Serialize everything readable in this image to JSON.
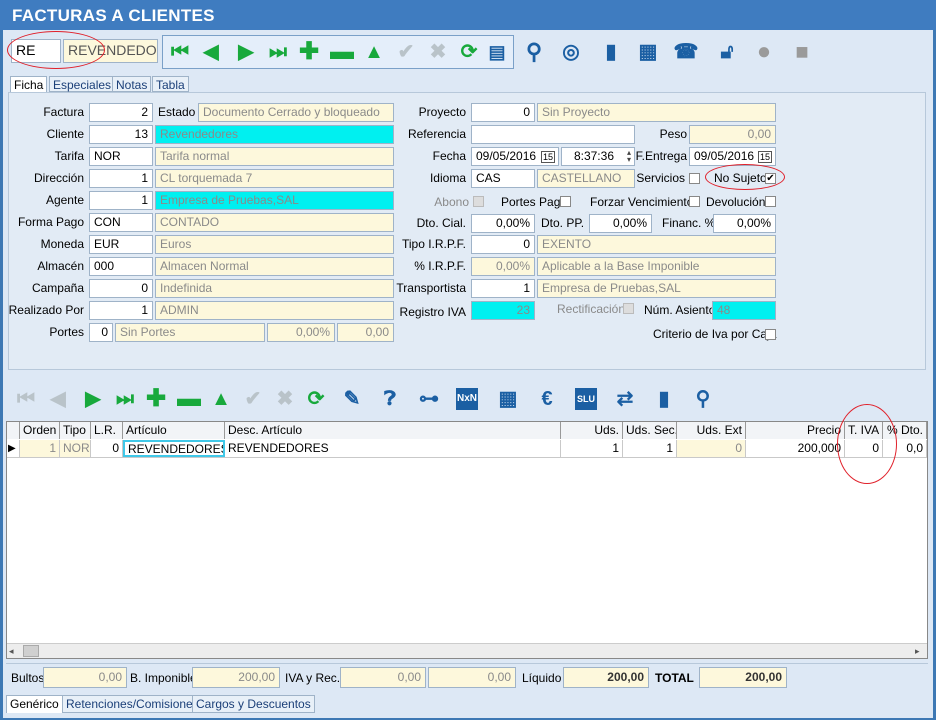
{
  "window": {
    "title": "FACTURAS A CLIENTES"
  },
  "top": {
    "code": "RE",
    "name": "REVENDEDO"
  },
  "tabs": [
    "Ficha",
    "Especiales",
    "Notas",
    "Tabla"
  ],
  "left": {
    "factura_label": "Factura",
    "factura": "2",
    "estado_label": "Estado",
    "estado": "Documento Cerrado y bloqueado",
    "cliente_label": "Cliente",
    "cliente": "13",
    "cliente_name": "Revendedores",
    "tarifa_label": "Tarifa",
    "tarifa": "NOR",
    "tarifa_name": "Tarifa normal",
    "direccion_label": "Dirección",
    "direccion": "1",
    "direccion_name": "CL  torquemada 7",
    "agente_label": "Agente",
    "agente": "1",
    "agente_name": "Empresa de Pruebas,SAL",
    "formapago_label": "Forma Pago",
    "formapago": "CON",
    "formapago_name": "CONTADO",
    "moneda_label": "Moneda",
    "moneda": "EUR",
    "moneda_name": "Euros",
    "almacen_label": "Almacén",
    "almacen": "000",
    "almacen_name": "Almacen Normal",
    "campana_label": "Campaña",
    "campana": "0",
    "campana_name": "Indefinida",
    "realizado_label": "Realizado Por",
    "realizado": "1",
    "realizado_name": "ADMIN",
    "portes_label": "Portes",
    "portes": "0",
    "portes_name": "Sin Portes",
    "portes_pct": "0,00%",
    "portes_val": "0,00"
  },
  "right": {
    "proyecto_label": "Proyecto",
    "proyecto": "0",
    "proyecto_name": "Sin Proyecto",
    "referencia_label": "Referencia",
    "referencia": "",
    "peso_label": "Peso",
    "peso": "0,00",
    "fecha_label": "Fecha",
    "fecha": "09/05/2016",
    "hora": "8:37:36",
    "fentrega_label": "F.Entrega",
    "fentrega": "09/05/2016",
    "idioma_label": "Idioma",
    "idioma": "CAS",
    "idioma_name": "CASTELLANO",
    "servicios_label": "Servicios",
    "nosujeto_label": "No Sujeto",
    "abono_label": "Abono",
    "portespag_label": "Portes Pag.",
    "forzar_label": "Forzar Vencimientos",
    "devolucion_label": "Devolución",
    "dtocial_label": "Dto. Cial.",
    "dtocial": "0,00%",
    "dtopp_label": "Dto. PP.",
    "dtopp": "0,00%",
    "financ_label": "Financ. %",
    "financ": "0,00%",
    "irpf_tipo_label": "Tipo I.R.P.F.",
    "irpf_tipo": "0",
    "irpf_tipo_name": "EXENTO",
    "irpf_pct_label": "% I.R.P.F.",
    "irpf_pct": "0,00%",
    "irpf_pct_name": "Aplicable a la Base Imponible",
    "transportista_label": "Transportista",
    "transportista": "1",
    "transportista_name": "Empresa de Pruebas,SAL",
    "registro_label": "Registro IVA",
    "registro": "23",
    "rectificacion_label": "Rectificación",
    "numasiento_label": "Núm. Asiento",
    "numasiento": "48",
    "criterio_label": "Criterio de Iva por Caja"
  },
  "grid": {
    "headers": [
      "Orden",
      "Tipo",
      "L.R.",
      "Artículo",
      "Desc. Artículo",
      "Uds.",
      "Uds. Sec.",
      "Uds. Ext",
      "Precio",
      "T. IVA",
      "% Dto."
    ],
    "row": [
      "1",
      "NOR",
      "0",
      "REVENDEDORES",
      "REVENDEDORES",
      "1",
      "1",
      "0",
      "200,000",
      "0",
      "0,0"
    ]
  },
  "footer": {
    "bultos_label": "Bultos",
    "bultos": "0,00",
    "bimponible_label": "B. Imponible",
    "bimponible": "200,00",
    "iva_label": "IVA y Rec.",
    "iva": "0,00",
    "rec": "0,00",
    "liquido_label": "Líquido",
    "liquido": "200,00",
    "total_label": "TOTAL",
    "total": "200,00"
  },
  "bottom_tabs": [
    "Genérico",
    "Retenciones/Comisiones",
    "Cargos y Descuentos"
  ],
  "icons": [
    "first-icon",
    "prev-icon",
    "next-icon",
    "last-icon",
    "add-icon",
    "delete-icon",
    "up-icon",
    "confirm-icon",
    "cancel-icon",
    "refresh-icon",
    "report-icon",
    "search-icon",
    "signal-icon",
    "exit-icon",
    "print-icon",
    "phone-icon",
    "unlock-icon",
    "circle-icon",
    "copy-icon"
  ]
}
